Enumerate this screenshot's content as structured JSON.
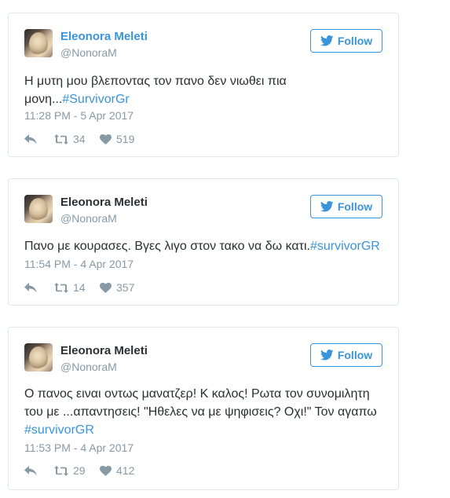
{
  "tweets": [
    {
      "name": "Eleonora Meleti",
      "handle": "@NonoraM",
      "follow_label": "Follow",
      "text": "Η μυτη μου βλεποντας τον πανο δεν νιωθει πια μονη...",
      "hashtag": "#SurvivorGr",
      "timestamp": "11:28 PM - 5 Apr 2017",
      "retweets": "34",
      "likes": "519"
    },
    {
      "name": "Eleonora Meleti",
      "handle": "@NonoraM",
      "follow_label": "Follow",
      "text": "Πανο με κουρασες. Βγες λιγο στον τακο να δω κατι.",
      "hashtag": "#survivorGR",
      "timestamp": "11:54 PM - 4 Apr 2017",
      "retweets": "14",
      "likes": "357"
    },
    {
      "name": "Eleonora Meleti",
      "handle": "@NonoraM",
      "follow_label": "Follow",
      "text": "Ο πανος ειναι οντως μανατζερ! Κ καλος! Ρωτα τον συνομιλητη του με ...απαντησεις! \"Ηθελες να με ψηφισεις? Οχι!\" Τον αγαπω ",
      "hashtag": "#survivorGR",
      "timestamp": "11:53 PM - 4 Apr 2017",
      "retweets": "29",
      "likes": "412"
    }
  ],
  "icons": {
    "follow": "twitter-bird-icon",
    "reply": "reply-icon",
    "retweet": "retweet-icon",
    "like": "heart-icon"
  },
  "colors": {
    "accent": "#3b94d9",
    "muted": "#8899a6",
    "text": "#292f33",
    "border": "#e1e8ed"
  }
}
